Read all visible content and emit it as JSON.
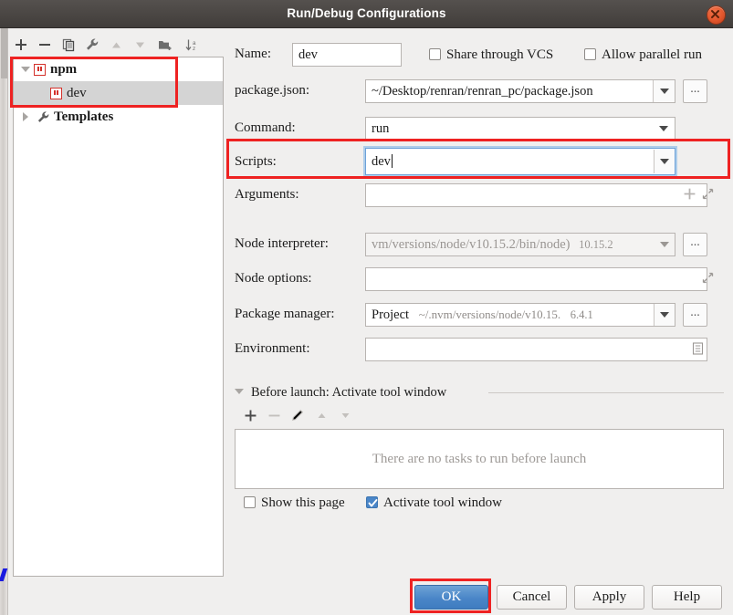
{
  "window": {
    "title": "Run/Debug Configurations",
    "close_icon": "close-icon"
  },
  "tree_toolbar": [
    {
      "name": "add-configuration-button",
      "icon": "plus-icon",
      "enabled": true
    },
    {
      "name": "remove-configuration-button",
      "icon": "minus-icon",
      "enabled": true
    },
    {
      "name": "copy-configuration-button",
      "icon": "copy-icon",
      "enabled": true
    },
    {
      "name": "edit-templates-button",
      "icon": "wrench-icon",
      "enabled": true
    },
    {
      "name": "move-up-button",
      "icon": "arrow-up-icon",
      "enabled": false
    },
    {
      "name": "move-down-button",
      "icon": "arrow-down-icon",
      "enabled": false
    },
    {
      "name": "move-into-folder-button",
      "icon": "folder-add-icon",
      "enabled": true
    },
    {
      "name": "sort-configurations-button",
      "icon": "sort-az-icon",
      "enabled": true
    }
  ],
  "tree": {
    "items": [
      {
        "label": "npm",
        "icon": "npm-icon",
        "expanded": true,
        "bold": true,
        "level": 0,
        "selected": false
      },
      {
        "label": "dev",
        "icon": "npm-icon",
        "level": 1,
        "selected": true
      },
      {
        "label": "Templates",
        "icon": "wrench-icon",
        "expanded": false,
        "bold": true,
        "level": 0,
        "selected": false
      }
    ]
  },
  "form": {
    "name_label": "Name:",
    "name_value": "dev",
    "share_vcs_label": "Share through VCS",
    "share_vcs_checked": false,
    "allow_parallel_label": "Allow parallel run",
    "allow_parallel_checked": false,
    "package_json_label": "package.json:",
    "package_json_value": "~/Desktop/renran/renran_pc/package.json",
    "command_label": "Command:",
    "command_value": "run",
    "scripts_label": "Scripts:",
    "scripts_value": "dev",
    "arguments_label": "Arguments:",
    "arguments_value": "",
    "node_interpreter_label": "Node interpreter:",
    "node_interpreter_value": "vm/versions/node/v10.15.2/bin/node)",
    "node_interpreter_version": "10.15.2",
    "node_options_label": "Node options:",
    "node_options_value": "",
    "package_manager_label": "Package manager:",
    "package_manager_value": "Project",
    "package_manager_path": "~/.nvm/versions/node/v10.15.",
    "package_manager_version": "6.4.1",
    "environment_label": "Environment:",
    "environment_value": "",
    "browse_label": "...",
    "expand_icon": "expand-icon",
    "add_argument_icon": "plus-icon",
    "environment_icon": "list-edit-icon"
  },
  "before_launch": {
    "title": "Before launch: Activate tool window",
    "empty_text": "There are no tasks to run before launch",
    "toolbar": [
      {
        "name": "add-task-button",
        "icon": "plus-icon",
        "enabled": true
      },
      {
        "name": "remove-task-button",
        "icon": "minus-icon",
        "enabled": false
      },
      {
        "name": "edit-task-button",
        "icon": "pencil-icon",
        "enabled": false
      },
      {
        "name": "task-move-up-button",
        "icon": "arrow-up-icon",
        "enabled": false
      },
      {
        "name": "task-move-down-button",
        "icon": "arrow-down-icon",
        "enabled": false
      }
    ],
    "show_page_label": "Show this page",
    "show_page_checked": false,
    "activate_window_label": "Activate tool window",
    "activate_window_checked": true
  },
  "buttons": {
    "ok": "OK",
    "cancel": "Cancel",
    "apply": "Apply",
    "help": "Help"
  },
  "colors": {
    "accent": "#4a86c8",
    "annotation": "#ee2222",
    "npm_red": "#d4312b",
    "titlebar": "#4b4744"
  }
}
